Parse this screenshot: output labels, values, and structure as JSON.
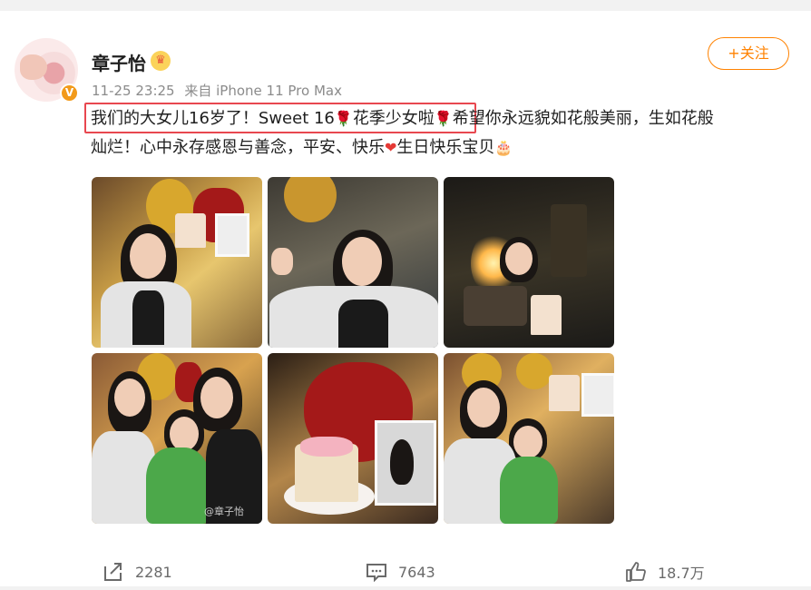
{
  "post": {
    "username": "章子怡",
    "verified_badge": "V",
    "timestamp": "11-25 23:25",
    "source": "来自 iPhone 11 Pro Max",
    "follow_label": "+关注",
    "text_line1_highlight": "我们的大女儿16岁了！Sweet 16",
    "text_line1_after_rose": "花季少女啦",
    "text_line1_rest": "希望你永远貌如花般美丽，生如花般",
    "text_line2_part1": "灿烂！心中永存感恩与善念，平安、快乐",
    "text_line2_part2": "生日快乐宝贝",
    "image_watermark": "@章子怡"
  },
  "actions": {
    "repost_count": "2281",
    "comment_count": "7643",
    "like_count": "18.7万"
  },
  "icons": [
    "verified-v-icon",
    "crown-icon",
    "rose-emoji-icon",
    "heart-emoji-icon",
    "cake-emoji-icon",
    "repost-icon",
    "comment-icon",
    "like-icon"
  ],
  "colors": {
    "accent": "#ff8200",
    "highlight_border": "#e8474f",
    "meta": "#8b8b8b"
  }
}
